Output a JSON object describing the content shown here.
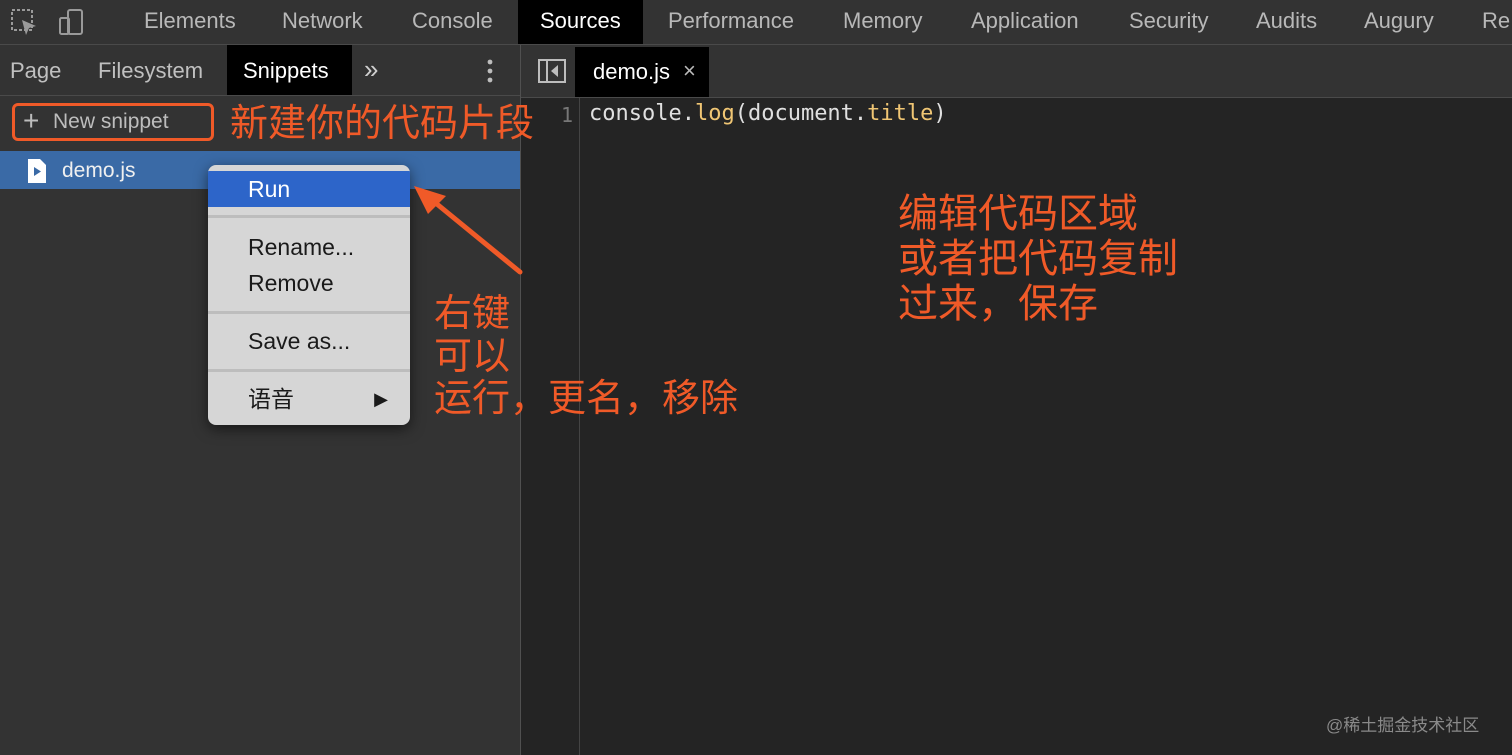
{
  "toolbar": {
    "icons": [
      "inspect-element-icon",
      "device-toolbar-icon"
    ],
    "tabs": [
      {
        "label": "Elements"
      },
      {
        "label": "Network"
      },
      {
        "label": "Console"
      },
      {
        "label": "Sources",
        "active": true
      },
      {
        "label": "Performance"
      },
      {
        "label": "Memory"
      },
      {
        "label": "Application"
      },
      {
        "label": "Security"
      },
      {
        "label": "Audits"
      },
      {
        "label": "Augury"
      },
      {
        "label": "Re"
      }
    ]
  },
  "navigator": {
    "tabs": [
      {
        "label": "Page"
      },
      {
        "label": "Filesystem"
      },
      {
        "label": "Snippets",
        "active": true
      }
    ],
    "more_label": "»",
    "new_snippet_label": "New snippet",
    "files": [
      {
        "name": "demo.js",
        "selected": true
      }
    ]
  },
  "editor": {
    "open_tab": "demo.js",
    "close_symbol": "×",
    "line_number": "1",
    "code": {
      "part1": "console.",
      "fn": "log",
      "part2": "(document.",
      "prop": "title",
      "part3": ")"
    }
  },
  "context_menu": {
    "items": [
      {
        "label": "Run",
        "selected": true
      },
      {
        "label": "Rename..."
      },
      {
        "label": "Remove"
      },
      {
        "label": "Save as..."
      },
      {
        "label": "语音",
        "has_submenu": true
      }
    ],
    "submenu_arrow": "▶"
  },
  "annotations": {
    "new_snippet": "新建你的代码片段",
    "right_click": "右键\n可以\n运行，更名，移除",
    "edit_area": "编辑代码区域\n或者把代码复制\n过来，保存"
  },
  "watermark": "@稀土掘金技术社区",
  "colors": {
    "annotation": "#f05a28",
    "selection": "#3a6aa6",
    "menu_highlight": "#2d65c9"
  }
}
